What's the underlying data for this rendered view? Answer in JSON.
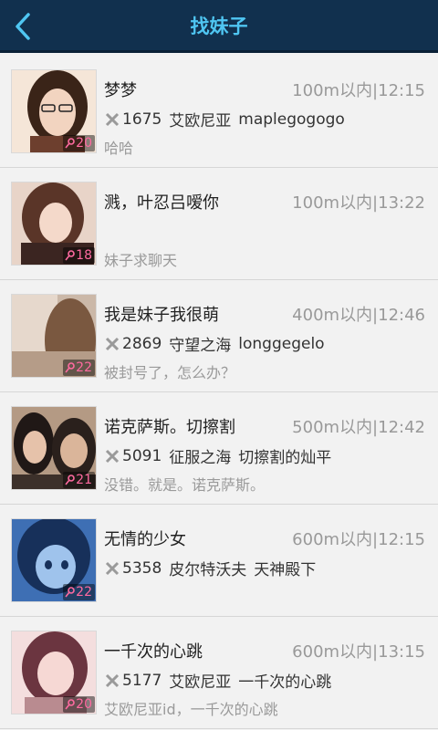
{
  "header": {
    "title": "找妹子"
  },
  "items": [
    {
      "name": "梦梦",
      "distance_time": "100m以内|12:15",
      "level": "1675",
      "server": "艾欧尼亚",
      "role": "maplegogogo",
      "message": "哈哈",
      "badge": "20",
      "avatar_colors": [
        "#f0d8c0",
        "#3a2418"
      ]
    },
    {
      "name": "溅，叶忍吕嗳你",
      "distance_time": "100m以内|13:22",
      "level": "",
      "server": "",
      "role": "",
      "message": "妹子求聊天",
      "badge": "18",
      "avatar_colors": [
        "#e9c8b7",
        "#5a3528"
      ]
    },
    {
      "name": "我是妹子我很萌",
      "distance_time": "400m以内|12:46",
      "level": "2869",
      "server": "守望之海",
      "role": "longgegelo",
      "message": "被封号了，怎么办？",
      "badge": "22",
      "avatar_colors": [
        "#d9c0a8",
        "#6a4a38"
      ]
    },
    {
      "name": "诺克萨斯。切擦割",
      "distance_time": "500m以内|12:42",
      "level": "5091",
      "server": "征服之海",
      "role": "切擦割的灿平",
      "message": "没错。就是。诺克萨斯。",
      "badge": "21",
      "avatar_colors": [
        "#d8b5a0",
        "#201816"
      ]
    },
    {
      "name": "无情的少女",
      "distance_time": "600m以内|12:15",
      "level": "5358",
      "server": "皮尔特沃夫",
      "role": "天神殿下",
      "message": "",
      "badge": "22",
      "avatar_colors": [
        "#5d8fd1",
        "#17305a"
      ]
    },
    {
      "name": "一千次的心跳",
      "distance_time": "600m以内|13:15",
      "level": "5177",
      "server": "艾欧尼亚",
      "role": "一千次的心跳",
      "message": "艾欧尼亚id，一千次的心跳",
      "badge": "20",
      "avatar_colors": [
        "#f3d2d2",
        "#6b3540"
      ]
    }
  ]
}
